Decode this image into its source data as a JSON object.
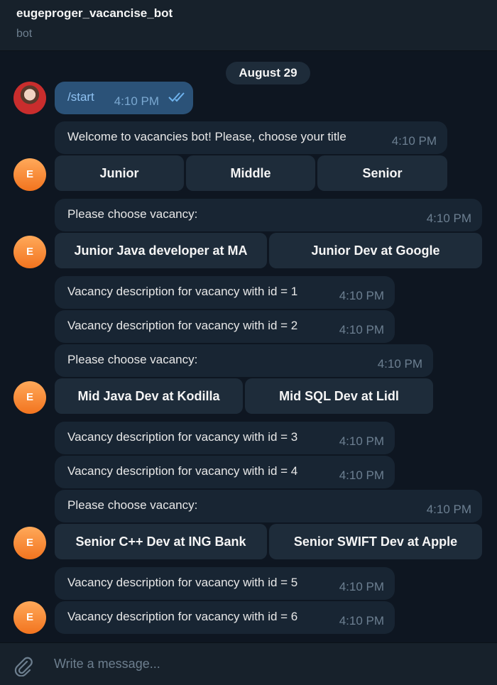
{
  "header": {
    "title": "eugeproger_vacancise_bot",
    "subtitle": "bot"
  },
  "date_separator": "August 29",
  "bot_avatar_letter": "E",
  "messages": {
    "start": {
      "text": "/start",
      "time": "4:10 PM"
    },
    "welcome": {
      "text": "Welcome to vacancies bot! Please, choose your title",
      "time": "4:10 PM",
      "buttons": [
        "Junior",
        "Middle",
        "Senior"
      ]
    },
    "choose1": {
      "text": "Please choose vacancy:",
      "time": "4:10 PM",
      "buttons": [
        "Junior Java developer at MA",
        "Junior Dev at Google"
      ]
    },
    "desc1": {
      "text": "Vacancy description for vacancy with id = 1",
      "time": "4:10 PM"
    },
    "desc2": {
      "text": "Vacancy description for vacancy with id = 2",
      "time": "4:10 PM"
    },
    "choose2": {
      "text": "Please choose vacancy:",
      "time": "4:10 PM",
      "buttons": [
        "Mid Java Dev at Kodilla",
        "Mid SQL Dev at Lidl"
      ]
    },
    "desc3": {
      "text": "Vacancy description for vacancy with id = 3",
      "time": "4:10 PM"
    },
    "desc4": {
      "text": "Vacancy description for vacancy with id = 4",
      "time": "4:10 PM"
    },
    "choose3": {
      "text": "Please choose vacancy:",
      "time": "4:10 PM",
      "buttons": [
        "Senior C++ Dev at ING Bank",
        "Senior SWIFT Dev at Apple"
      ]
    },
    "desc5": {
      "text": "Vacancy description for vacancy with id = 5",
      "time": "4:10 PM"
    },
    "desc6": {
      "text": "Vacancy description for vacancy with id = 6",
      "time": "4:10 PM"
    }
  },
  "composer": {
    "placeholder": "Write a message..."
  },
  "icons": {
    "attach": "paperclip-icon",
    "read_status": "double-check-icon"
  },
  "colors": {
    "background": "#0e1621",
    "header": "#17212b",
    "incoming_bubble": "#182533",
    "outgoing_bubble": "#2b5278",
    "keyboard_button": "#1e2c3a",
    "bot_avatar": "#f2741f"
  }
}
